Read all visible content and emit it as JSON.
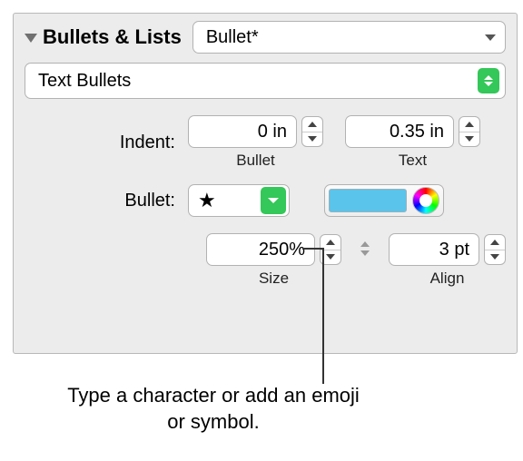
{
  "section": {
    "title": "Bullets & Lists",
    "style": "Bullet*",
    "type": "Text Bullets"
  },
  "indent": {
    "label": "Indent:",
    "bullet_value": "0 in",
    "bullet_sublabel": "Bullet",
    "text_value": "0.35 in",
    "text_sublabel": "Text"
  },
  "bullet": {
    "label": "Bullet:",
    "glyph": "★",
    "color": "#5ac4ea"
  },
  "size": {
    "value": "250%",
    "label": "Size"
  },
  "align": {
    "value": "3 pt",
    "label": "Align"
  },
  "caption": "Type a character or add an emoji or symbol."
}
